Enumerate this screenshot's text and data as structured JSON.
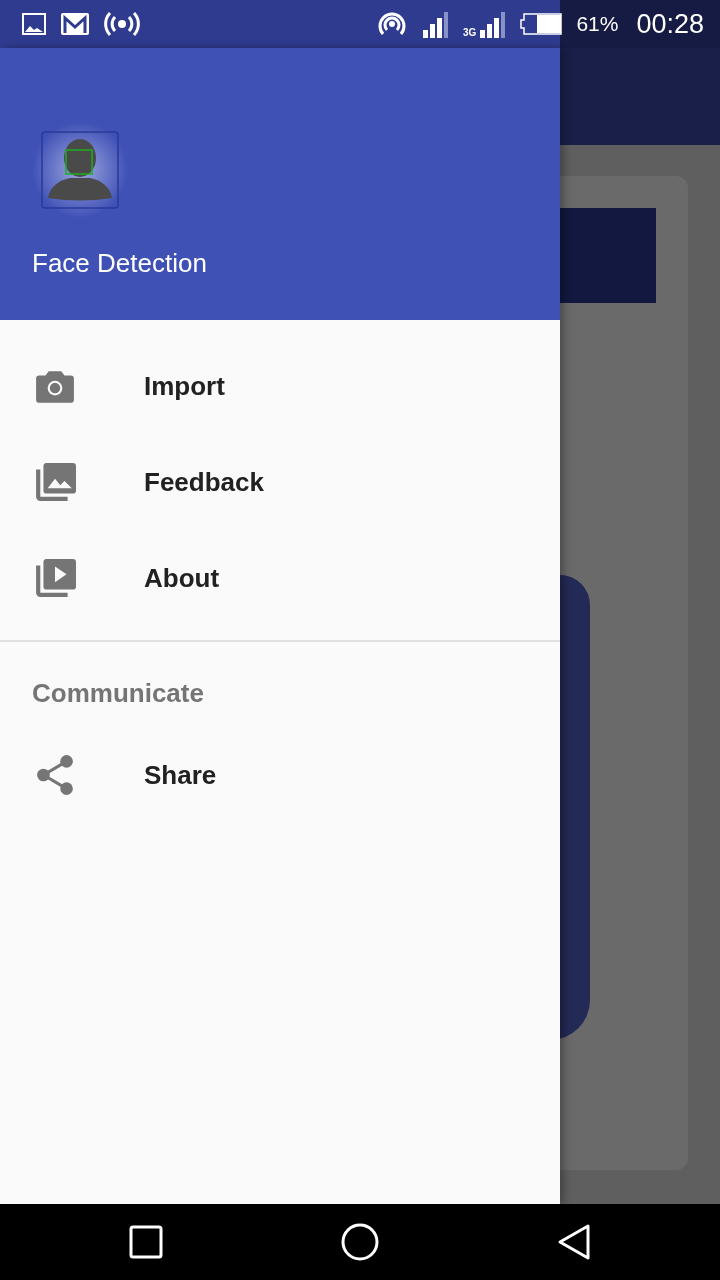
{
  "status_bar": {
    "network": "3G",
    "battery": "61%",
    "time": "00:28"
  },
  "drawer": {
    "title": "Face Detection",
    "sections": [
      {
        "items": [
          {
            "label": "Import",
            "kind": "camera"
          },
          {
            "label": "Feedback",
            "kind": "photos"
          },
          {
            "label": "About",
            "kind": "video"
          }
        ]
      },
      {
        "heading": "Communicate",
        "items": [
          {
            "label": "Share",
            "kind": "share"
          }
        ]
      }
    ]
  }
}
